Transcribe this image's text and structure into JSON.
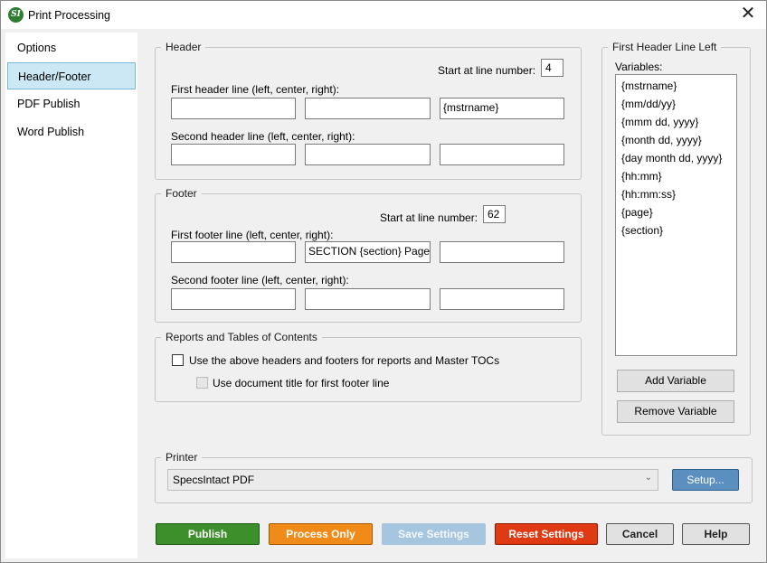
{
  "window": {
    "title": "Print Processing",
    "app_icon": "SI"
  },
  "sidebar": {
    "items": [
      {
        "label": "Options"
      },
      {
        "label": "Header/Footer"
      },
      {
        "label": "PDF Publish"
      },
      {
        "label": "Word Publish"
      }
    ]
  },
  "header": {
    "legend": "Header",
    "start_label": "Start at line number:",
    "start_value": "4",
    "first_line_label": "First header line (left, center, right):",
    "first_line": [
      "",
      "",
      "{mstrname}"
    ],
    "second_line_label": "Second header line (left, center, right):",
    "second_line": [
      "",
      "",
      ""
    ]
  },
  "footer": {
    "legend": "Footer",
    "start_label": "Start at line number:",
    "start_value": "62",
    "first_line_label": "First footer line (left, center, right):",
    "first_line": [
      "",
      "SECTION {section}  Page {",
      ""
    ],
    "second_line_label": "Second footer line (left, center, right):",
    "second_line": [
      "",
      "",
      ""
    ]
  },
  "reports": {
    "legend": "Reports and Tables of Contents",
    "use_headers_label": "Use the above headers and footers for reports and Master TOCs",
    "use_headers_checked": false,
    "use_doc_title_label": "Use document title for first footer line",
    "use_doc_title_checked": false
  },
  "variables_panel": {
    "legend": "First Header Line Left",
    "variables_label": "Variables:",
    "items": [
      "{mstrname}",
      "{mm/dd/yy}",
      "{mmm dd, yyyy}",
      "{month dd, yyyy}",
      "{day month dd, yyyy}",
      "{hh:mm}",
      "{hh:mm:ss}",
      "{page}",
      "{section}"
    ],
    "add_label": "Add Variable",
    "remove_label": "Remove Variable"
  },
  "printer": {
    "legend": "Printer",
    "selected": "SpecsIntact PDF",
    "setup_label": "Setup..."
  },
  "actions": {
    "publish": "Publish",
    "process_only": "Process Only",
    "save_settings": "Save Settings",
    "reset_settings": "Reset Settings",
    "cancel": "Cancel",
    "help": "Help"
  },
  "colors": {
    "publish": "#3d8f2c",
    "process_only": "#f08a18",
    "save_settings_disabled": "#a6c6e0",
    "reset_settings": "#e03a14",
    "setup": "#5b8fc0",
    "sidebar_active": "#cce8f4"
  }
}
